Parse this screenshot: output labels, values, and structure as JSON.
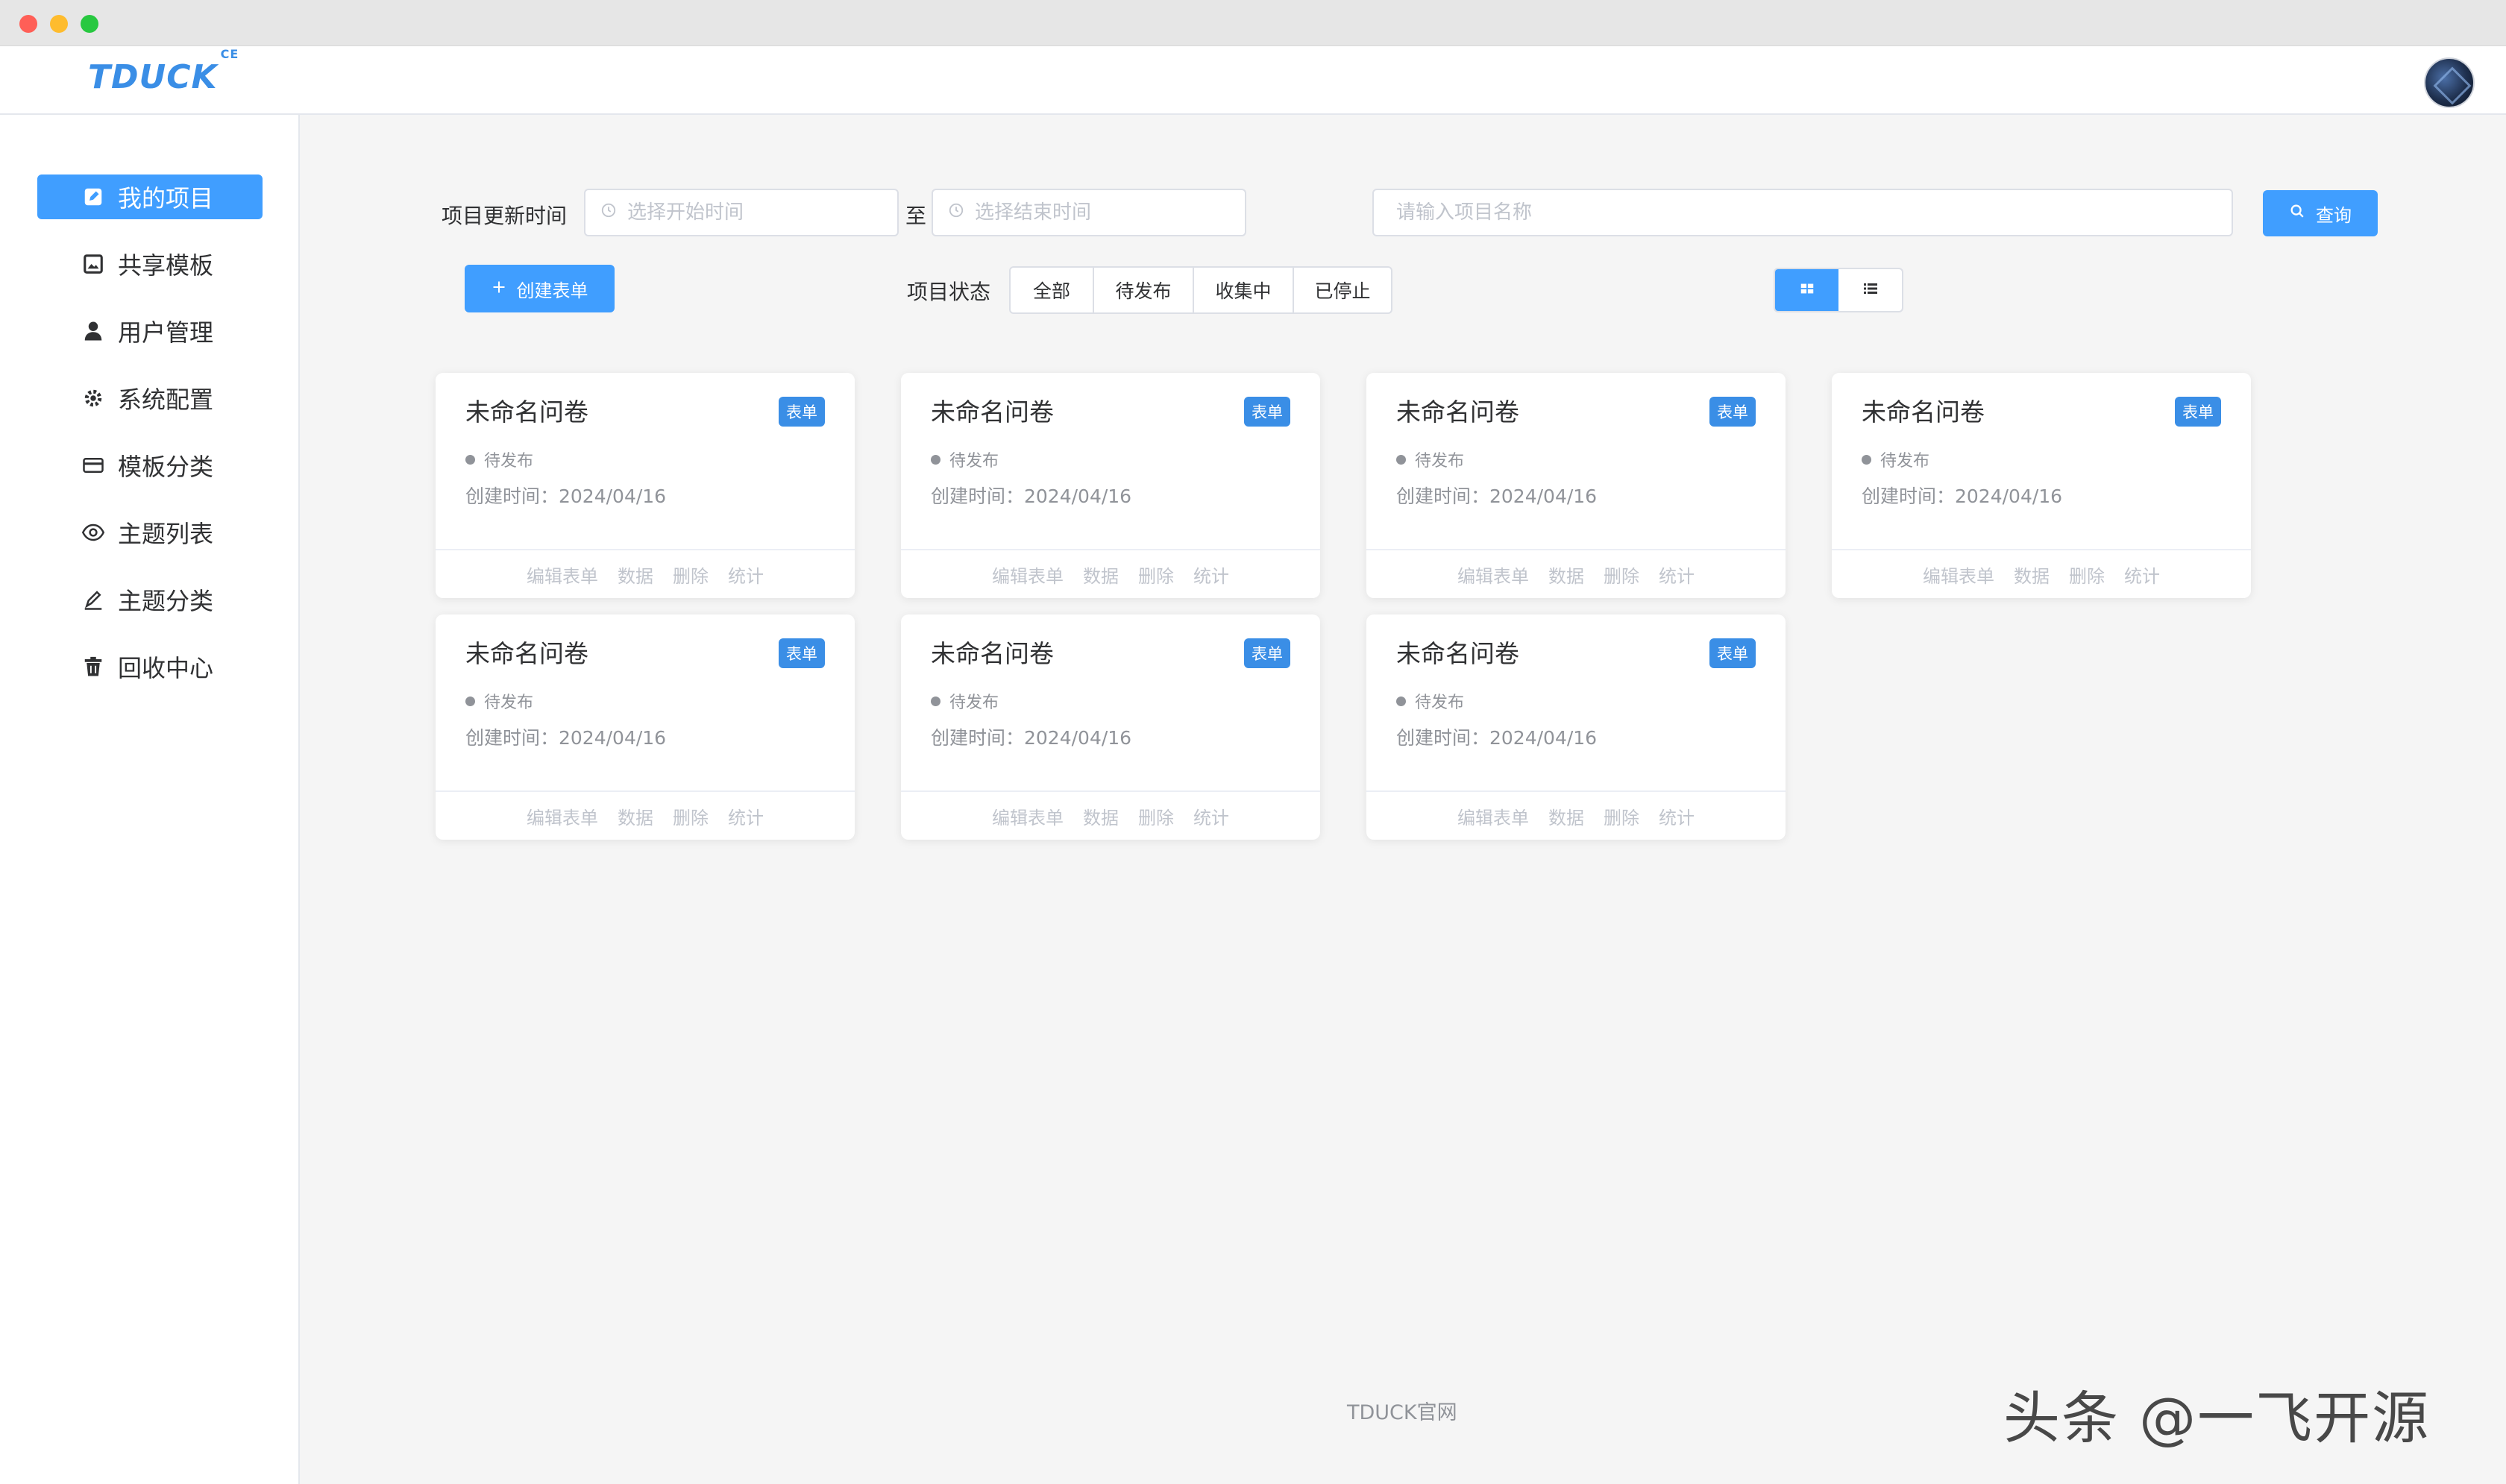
{
  "app": {
    "logo_text": "TDUCK",
    "logo_superscript": "CE"
  },
  "sidebar": {
    "items": [
      {
        "label": "我的项目",
        "icon": "edit-icon",
        "active": true
      },
      {
        "label": "共享模板",
        "icon": "image-icon",
        "active": false
      },
      {
        "label": "用户管理",
        "icon": "user-icon",
        "active": false
      },
      {
        "label": "系统配置",
        "icon": "gear-icon",
        "active": false
      },
      {
        "label": "模板分类",
        "icon": "card-icon",
        "active": false
      },
      {
        "label": "主题列表",
        "icon": "eye-icon",
        "active": false
      },
      {
        "label": "主题分类",
        "icon": "pen-icon",
        "active": false
      },
      {
        "label": "回收中心",
        "icon": "trash-icon",
        "active": false
      }
    ]
  },
  "filters": {
    "update_time_label": "项目更新时间",
    "start_placeholder": "选择开始时间",
    "range_separator": "至",
    "end_placeholder": "选择结束时间",
    "name_placeholder": "请输入项目名称",
    "query_label": "查询",
    "create_label": "创建表单",
    "status_label": "项目状态",
    "status_options": [
      "全部",
      "待发布",
      "收集中",
      "已停止"
    ]
  },
  "accent_color": "#409eff",
  "cards": [
    {
      "title": "未命名问卷",
      "tag": "表单",
      "status": "待发布",
      "created": "创建时间：2024/04/16"
    },
    {
      "title": "未命名问卷",
      "tag": "表单",
      "status": "待发布",
      "created": "创建时间：2024/04/16"
    },
    {
      "title": "未命名问卷",
      "tag": "表单",
      "status": "待发布",
      "created": "创建时间：2024/04/16"
    },
    {
      "title": "未命名问卷",
      "tag": "表单",
      "status": "待发布",
      "created": "创建时间：2024/04/16"
    },
    {
      "title": "未命名问卷",
      "tag": "表单",
      "status": "待发布",
      "created": "创建时间：2024/04/16"
    },
    {
      "title": "未命名问卷",
      "tag": "表单",
      "status": "待发布",
      "created": "创建时间：2024/04/16"
    },
    {
      "title": "未命名问卷",
      "tag": "表单",
      "status": "待发布",
      "created": "创建时间：2024/04/16"
    }
  ],
  "card_actions": {
    "edit": "编辑表单",
    "data": "数据",
    "delete": "删除",
    "stats": "统计"
  },
  "footer": {
    "link": "TDUCK官网"
  },
  "watermark": "头条 @一飞开源"
}
